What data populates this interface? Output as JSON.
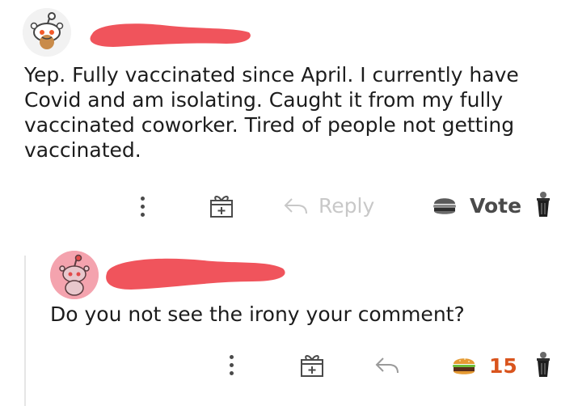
{
  "comments": [
    {
      "body": "Yep. Fully vaccinated since April. I currently have Covid and am isolating. Caught it from my fully vaccinated coworker. Tired of people not getting vaccinated.",
      "actions": {
        "reply_label": "Reply",
        "vote_label": "Vote"
      }
    },
    {
      "body": "Do you not see the irony your comment?",
      "actions": {
        "score": "15"
      }
    }
  ],
  "colors": {
    "redaction": "#f0545c",
    "score": "#d9541d",
    "reply_disabled": "#c8c8c8",
    "avatar_pink": "#f4a3ae"
  },
  "icons": [
    "more-options-icon",
    "gift-award-icon",
    "reply-arrow-icon",
    "upvote-burger-icon",
    "downvote-trashcan-icon",
    "snoo-avatar-icon"
  ]
}
